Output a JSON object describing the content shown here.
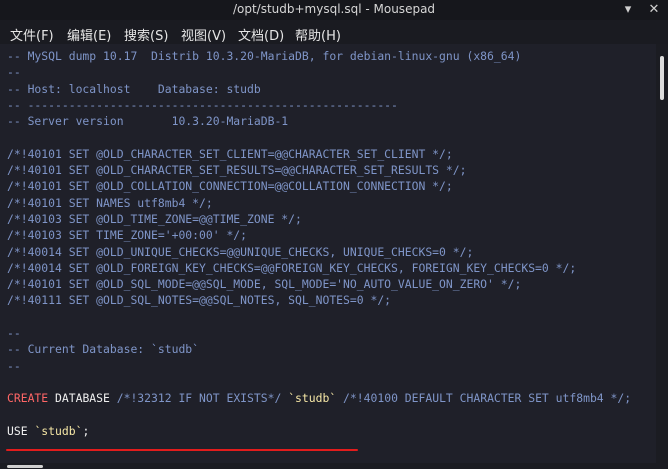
{
  "window": {
    "title": "/opt/studb+mysql.sql - Mousepad",
    "minimize_glyph": "▾",
    "close_glyph": "✕"
  },
  "menu": [
    {
      "label": "文件(F)"
    },
    {
      "label": "编辑(E)"
    },
    {
      "label": "搜索(S)"
    },
    {
      "label": "视图(V)"
    },
    {
      "label": "文档(D)"
    },
    {
      "label": "帮助(H)"
    }
  ],
  "editor": {
    "lines": [
      "-- MySQL dump 10.17  Distrib 10.3.20-MariaDB, for debian-linux-gnu (x86_64)",
      "--",
      "-- Host: localhost    Database: studb",
      "-- ------------------------------------------------------",
      "-- Server version       10.3.20-MariaDB-1",
      "",
      "/*!40101 SET @OLD_CHARACTER_SET_CLIENT=@@CHARACTER_SET_CLIENT */;",
      "/*!40101 SET @OLD_CHARACTER_SET_RESULTS=@@CHARACTER_SET_RESULTS */;",
      "/*!40101 SET @OLD_COLLATION_CONNECTION=@@COLLATION_CONNECTION */;",
      "/*!40101 SET NAMES utf8mb4 */;",
      "/*!40103 SET @OLD_TIME_ZONE=@@TIME_ZONE */;",
      "/*!40103 SET TIME_ZONE='+00:00' */;",
      "/*!40014 SET @OLD_UNIQUE_CHECKS=@@UNIQUE_CHECKS, UNIQUE_CHECKS=0 */;",
      "/*!40014 SET @OLD_FOREIGN_KEY_CHECKS=@@FOREIGN_KEY_CHECKS, FOREIGN_KEY_CHECKS=0 */;",
      "/*!40101 SET @OLD_SQL_MODE=@@SQL_MODE, SQL_MODE='NO_AUTO_VALUE_ON_ZERO' */;",
      "/*!40111 SET @OLD_SQL_NOTES=@@SQL_NOTES, SQL_NOTES=0 */;",
      "",
      "--",
      "-- Current Database: `studb`",
      "--",
      "",
      "",
      "",
      "USE `studb`;"
    ],
    "highlight_line": {
      "create": "CREATE",
      "database": " DATABASE ",
      "cond": "/*!32312 IF NOT EXISTS*/ ",
      "db": "`studb`",
      "rest": " /*!40100 DEFAULT CHARACTER SET utf8mb4 */;"
    }
  },
  "colors": {
    "background": "#1f2029",
    "comment": "#8e9ec8",
    "keyword": "#f0f0f0",
    "string": "#f6e7a6",
    "highlight_underline": "#e21c1c"
  }
}
